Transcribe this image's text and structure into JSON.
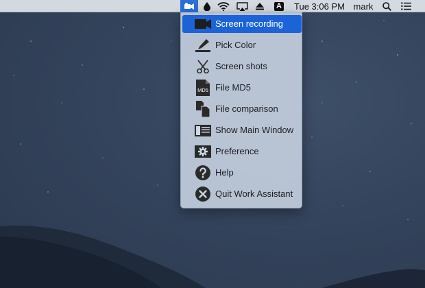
{
  "menubar": {
    "app_icon": "work-assistant-icon",
    "status_icons": [
      "droplet-icon",
      "wifi-icon",
      "airplay-icon",
      "eject-icon",
      "input-source-icon"
    ],
    "input_source_label": "A",
    "clock": "Tue 3:06 PM",
    "user": "mark",
    "right_icons": [
      "spotlight-search-icon",
      "notification-center-icon"
    ]
  },
  "menu": {
    "items": [
      {
        "label": "Screen recording",
        "icon": "video-camera-icon",
        "selected": true
      },
      {
        "label": "Pick Color",
        "icon": "color-picker-icon",
        "selected": false
      },
      {
        "label": "Screen shots",
        "icon": "scissors-icon",
        "selected": false
      },
      {
        "label": "File MD5",
        "icon": "md5-file-icon",
        "selected": false
      },
      {
        "label": "File comparison",
        "icon": "file-compare-icon",
        "selected": false
      },
      {
        "label": "Show Main Window",
        "icon": "main-window-icon",
        "selected": false
      },
      {
        "label": "Preference",
        "icon": "gear-icon",
        "selected": false
      },
      {
        "label": "Help",
        "icon": "help-icon",
        "selected": false
      },
      {
        "label": "Quit Work Assistant",
        "icon": "quit-icon",
        "selected": false
      }
    ],
    "md5_icon_text": "MD5"
  },
  "colors": {
    "menubar_bg": "#e1e5ec",
    "selection": "#1b63d6",
    "menu_bg": "#cdd7e6",
    "desktop": "#34435a"
  }
}
